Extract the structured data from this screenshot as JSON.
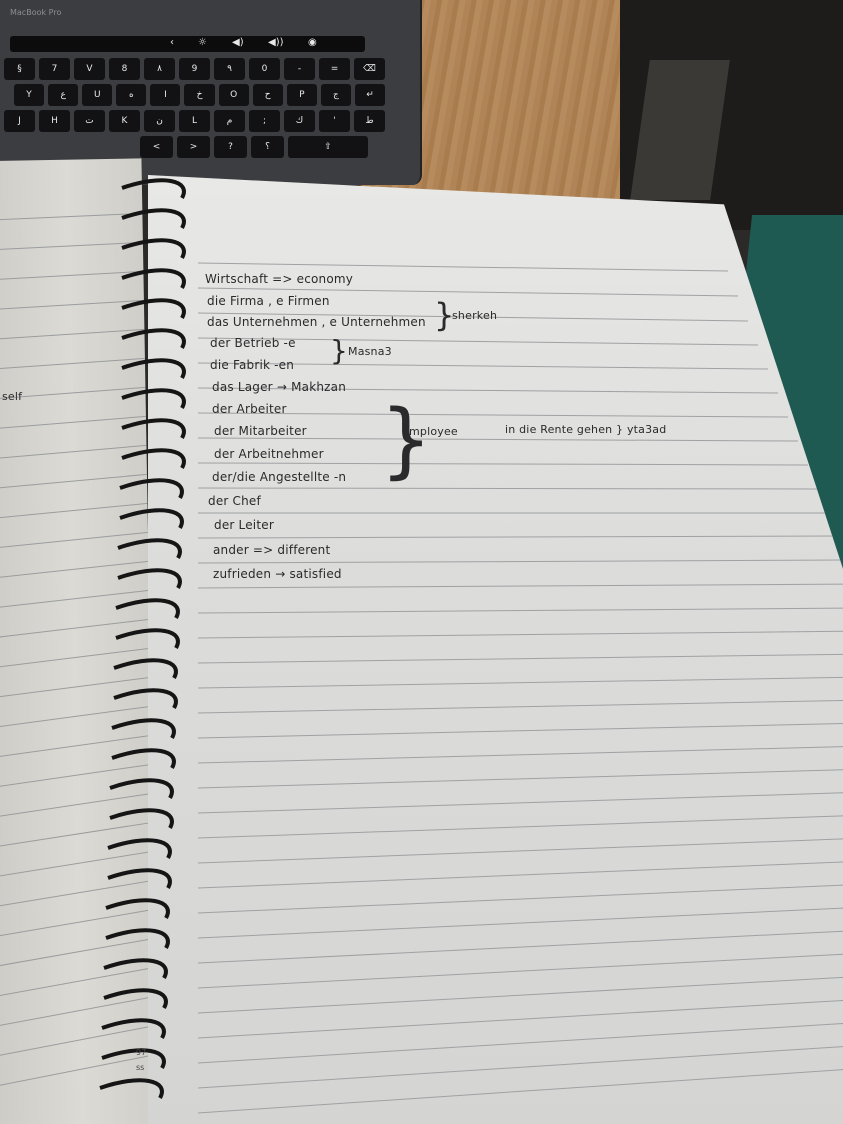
{
  "laptop": {
    "brand": "MacBook Pro",
    "touchbar_icons": [
      "‹",
      "☼",
      "◀)",
      "◀))",
      "◉"
    ],
    "key_rows": [
      [
        "§",
        "7",
        "V",
        "8",
        "٨",
        "9",
        "٩",
        "0",
        "-",
        "=",
        "⌫"
      ],
      [
        "Y",
        "ع",
        "U",
        "ه",
        "I",
        "خ",
        "O",
        "ح",
        "P",
        "ج",
        "↵"
      ],
      [
        "J",
        "H",
        "ت",
        "K",
        "ن",
        "L",
        "م",
        ";",
        "ك",
        "'",
        "ط"
      ],
      [
        "<",
        ">",
        "?",
        "؟",
        "⇧"
      ]
    ]
  },
  "notebook": {
    "left_margin_note": "self",
    "lines": [
      "Wirtschaft => economy",
      "die Firma , e Firmen",
      "das Unternehmen , e Unternehmen",
      "der Betrieb -e",
      "die Fabrik -en",
      "das Lager → Makhzan",
      "der Arbeiter",
      "der Mitarbeiter",
      "der Arbeitnehmer",
      "der/die Angestellte -n",
      "der Chef",
      "der Leiter",
      "ander => different",
      "zufrieden → satisfied"
    ],
    "bracket_notes": {
      "company": "sherkeh",
      "factory": "Masna3",
      "employee": "employee",
      "retire": "in die Rente gehen } yta3ad"
    },
    "spine_marks": [
      "97",
      "ss"
    ]
  },
  "colors": {
    "ink": "#2a2a2c",
    "paper": "#e4e4e2",
    "desk": "#b08456",
    "cover": "#1f5a52"
  }
}
